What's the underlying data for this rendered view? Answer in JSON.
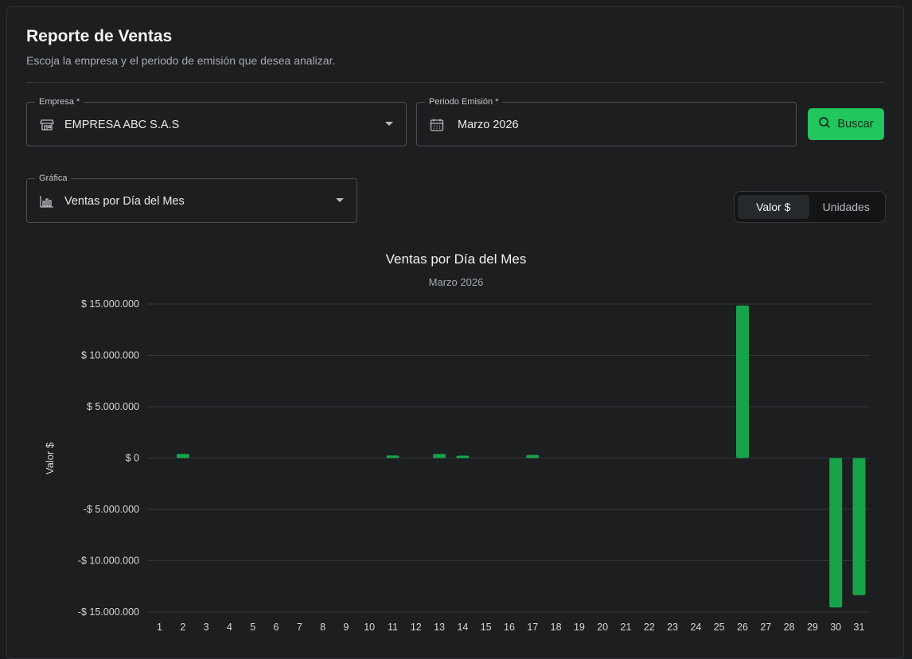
{
  "header": {
    "title": "Reporte de Ventas",
    "subtitle": "Escoja la empresa y el periodo de emisión que desea analizar."
  },
  "filters": {
    "empresa": {
      "label": "Empresa",
      "required_mark": "*",
      "value": "EMPRESA ABC S.A.S",
      "icon": "store-icon"
    },
    "periodo": {
      "label": "Periodo Emisión",
      "required_mark": "*",
      "value": "Marzo 2026",
      "icon": "calendar-icon"
    },
    "grafica": {
      "label": "Gráfica",
      "value": "Ventas por Día del Mes",
      "icon": "bar-chart-icon"
    },
    "search_button": {
      "label": "Buscar",
      "icon": "search-icon"
    }
  },
  "toggle": {
    "options": [
      "Valor $",
      "Unidades"
    ],
    "selected": "Valor $"
  },
  "colors": {
    "accent": "#22c55e",
    "bar": "#16a34a"
  },
  "chart_data": {
    "type": "bar",
    "title": "Ventas por Día del Mes",
    "subtitle": "Marzo 2026",
    "xlabel": "",
    "ylabel": "Valor $",
    "ylim": [
      -15000000,
      15000000
    ],
    "yticks": [
      15000000,
      10000000,
      5000000,
      0,
      -5000000,
      -10000000,
      -15000000
    ],
    "ytick_labels": [
      "$ 15.000.000",
      "$ 10.000.000",
      "$ 5.000.000",
      "$ 0",
      "-$ 5.000.000",
      "-$ 10.000.000",
      "-$ 15.000.000"
    ],
    "grid": true,
    "categories": [
      "1",
      "2",
      "3",
      "4",
      "5",
      "6",
      "7",
      "8",
      "9",
      "10",
      "11",
      "12",
      "13",
      "14",
      "15",
      "16",
      "17",
      "18",
      "19",
      "20",
      "21",
      "22",
      "23",
      "24",
      "25",
      "26",
      "27",
      "28",
      "29",
      "30",
      "31"
    ],
    "values": [
      0,
      400000,
      0,
      0,
      0,
      0,
      0,
      0,
      0,
      0,
      250000,
      0,
      400000,
      100000,
      0,
      0,
      300000,
      0,
      0,
      0,
      0,
      0,
      0,
      0,
      0,
      14850000,
      0,
      0,
      0,
      -14550000,
      -13350000
    ]
  }
}
